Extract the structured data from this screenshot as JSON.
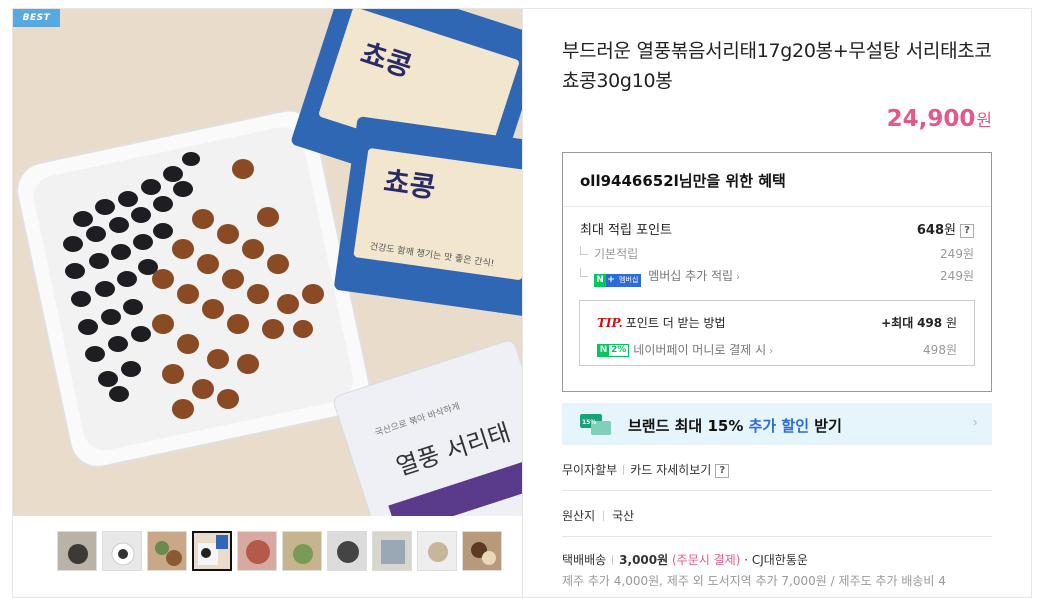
{
  "badge": {
    "label": "BEST"
  },
  "product": {
    "title": "부드러운 열풍볶음서리태17g20봉+무설탕 서리태초코 쵸콩30g10봉",
    "price": "24,900",
    "price_unit": "원"
  },
  "image": {
    "package_brand": "쵸콩",
    "package_tagline": "건강도 함께 챙기는 맛 좋은 간식!",
    "bag_text": "열풍 서리태",
    "bag_caption": "국산으로 볶아 바삭하게"
  },
  "thumbnails": {
    "count": 10,
    "selected_index": 3
  },
  "benefits": {
    "title": "oll9446652l님만을 위한 혜택",
    "max_points_label": "최대 적립 포인트",
    "max_points_value": "648",
    "max_points_unit": "원",
    "help": "?",
    "basic_label": "기본적립",
    "basic_value": "249원",
    "membership_badge": "멤버십",
    "membership_label": "멤버십 추가 적립",
    "membership_value": "249원",
    "tip_prefix": "TIP.",
    "tip_title": "포인트 더 받는 방법",
    "tip_value_prefix": "+최대",
    "tip_value": "498",
    "tip_value_unit": "원",
    "npay_badge_pct": "2%",
    "npay_label": "네이버페이 머니로 결제 시",
    "npay_value": "498원"
  },
  "brand_banner": {
    "text_prefix": "브랜드 최대 15%",
    "text_accent": "추가 할인",
    "text_suffix": "받기",
    "icon_pct": "15%"
  },
  "card": {
    "installment": "무이자할부",
    "details": "카드 자세히보기",
    "help": "?"
  },
  "origin": {
    "label": "원산지",
    "value": "국산"
  },
  "shipping": {
    "label": "택배배송",
    "fee": "3,000원",
    "condition": "(주문시 결제)",
    "courier": "· CJ대한통운",
    "extra": "제주 추가 4,000원, 제주 외 도서지역 추가 7,000원 / 제주도 추가 배송비 4"
  },
  "colors": {
    "price": "#e4588a",
    "accent_blue": "#2d6bd5",
    "naver_green": "#03c75a",
    "badge_blue": "#57a9e0",
    "banner_bg": "#e6f4fc"
  }
}
